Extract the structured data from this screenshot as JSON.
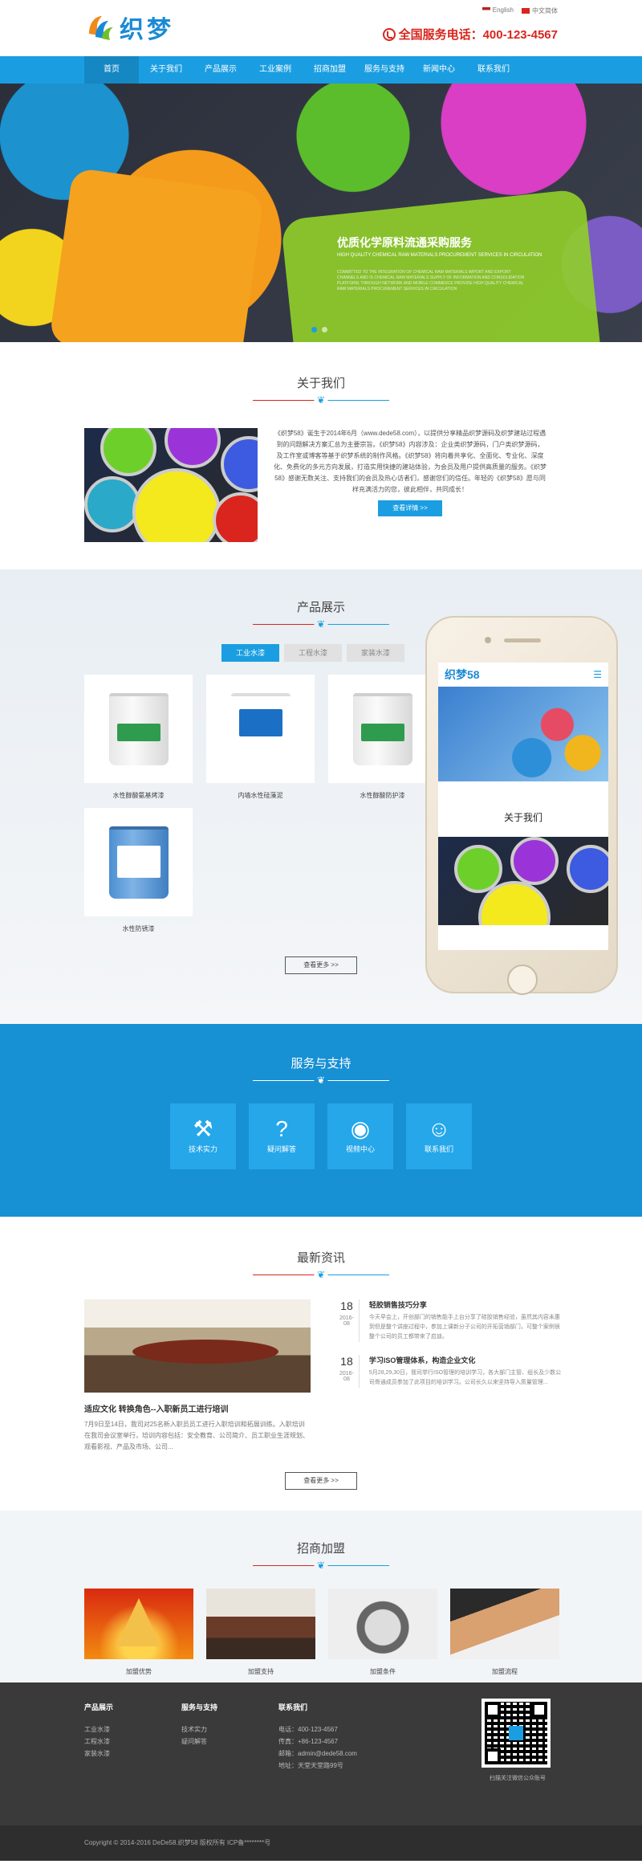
{
  "header": {
    "logo_text": "织梦",
    "lang_en": "English",
    "lang_cn": "中文简体",
    "phone": "全国服务电话：400-123-4567"
  },
  "nav": [
    "首页",
    "关于我们",
    "产品展示",
    "工业案例",
    "招商加盟",
    "服务与支持",
    "新闻中心",
    "联系我们"
  ],
  "banner": {
    "title": "优质化学原料流通采购服务",
    "subtitle": "HIGH QUALITY CHEMICAL RAW MATERIALS PROCUREMENT SERVICES IN CIRCULATION",
    "desc": "COMMITTED TO THE INTEGRATION OF CHEMICAL RAW MATERIALS IMPORT AND EXPORT CHANNELS AND IS CHEMICAL RAW MATERIALS SUPPLY OF INFORMATION AND CONSOLIDATION PLATFORM, THROUGH NETWORK AND MOBILE COMMERCE PROVIDE HIGH QUALITY CHEMICAL RAW MATERIALS PROCUREMENT SERVICES IN CIRCULATION"
  },
  "about": {
    "title": "关于我们",
    "text": "《织梦58》诞生于2014年6月（www.dede58.com），以提供分享精品织梦源码及织梦建站过程遇到的问题解决方案汇总为主要宗旨。《织梦58》内容涉及：企业类织梦源码，门户类织梦源码，及工作室或博客等基于织梦系统的制作风格。《织梦58》将向着共享化、全面化、专业化、深度化、免费化的多元方向发展，打造实用快捷的建站体验，为会员及用户提供高质量的服务。《织梦58》感谢无数关注、支持我们的会员及热心访者们，感谢您们的信任。年轻的《织梦58》愿与同样充满活力的您，彼此相伴，共同成长！",
    "button": "查看详情 >>"
  },
  "products": {
    "title": "产品展示",
    "tabs": [
      "工业水漆",
      "工程水漆",
      "家装水漆"
    ],
    "items": [
      {
        "name": "水性醇酸氨基烤漆",
        "label_color": "#2f9b4e"
      },
      {
        "name": "内墙水性硅藻泥",
        "label_color": "#1b6fc4"
      },
      {
        "name": "水性醇酸防护漆",
        "label_color": "#2f9b4e"
      },
      {
        "name": "水性防锈漆",
        "label_color": "#2e7fcc"
      }
    ],
    "more": "查看更多 >>"
  },
  "phone_mock": {
    "logo": "织梦58",
    "about_title": "关于我们"
  },
  "service": {
    "title": "服务与支持",
    "items": [
      {
        "icon": "tools-icon",
        "glyph": "⚒",
        "label": "技术实力"
      },
      {
        "icon": "question-icon",
        "glyph": "?",
        "label": "疑问解答"
      },
      {
        "icon": "video-icon",
        "glyph": "◉",
        "label": "视频中心"
      },
      {
        "icon": "contact-icon",
        "glyph": "☺",
        "label": "联系我们"
      }
    ]
  },
  "news": {
    "title": "最新资讯",
    "feature_title": "适应文化 转换角色--入职新员工进行培训",
    "feature_text": "7月9日至14日，我司对25名新入职员员工进行入职培训和拓展训练。入职培训在我司会议室举行，培训内容包括：安全教育、公司简介、员工职业生涯规划、观看影视、产品及市场、公司...",
    "items": [
      {
        "day": "18",
        "month": "2016-08",
        "title": "轻胶销售技巧分享",
        "text": "今天早会上，开创部门的销售能手上台分享了硅胶销售经验，虽然其内容未惠到但是整个讲座过程中，参加上课新分子公司的开拓营销部门，可整个案例很整个公司的员工都带来了启迪。"
      },
      {
        "day": "18",
        "month": "2016-08",
        "title": "学习ISO管理体系，构造企业文化",
        "text": "5月28,29,30日，我司举行ISO管理的培训学习，各大部门主管、组长及少数公司骨通成员参加了此项目的培训学习。公司长久以来坚持导入质量管理..."
      }
    ],
    "more": "查看更多 >>"
  },
  "join": {
    "title": "招商加盟",
    "items": [
      "加盟优势",
      "加盟支持",
      "加盟条件",
      "加盟流程"
    ]
  },
  "footer": {
    "col1_title": "产品展示",
    "col1": [
      "工业水漆",
      "工程水漆",
      "家装水漆"
    ],
    "col2_title": "服务与支持",
    "col2": [
      "技术实力",
      "疑问解答"
    ],
    "col3_title": "联系我们",
    "col3": [
      "电话：400-123-4567",
      "传真：+86-123-4567",
      "邮箱：admin@dede58.com",
      "地址：天堂天堂路99号"
    ],
    "qr_caption": "扫描关注微信公众账号",
    "copyright": "Copyright © 2014-2016 DeDe58.织梦58 版权所有    ICP备********号"
  }
}
